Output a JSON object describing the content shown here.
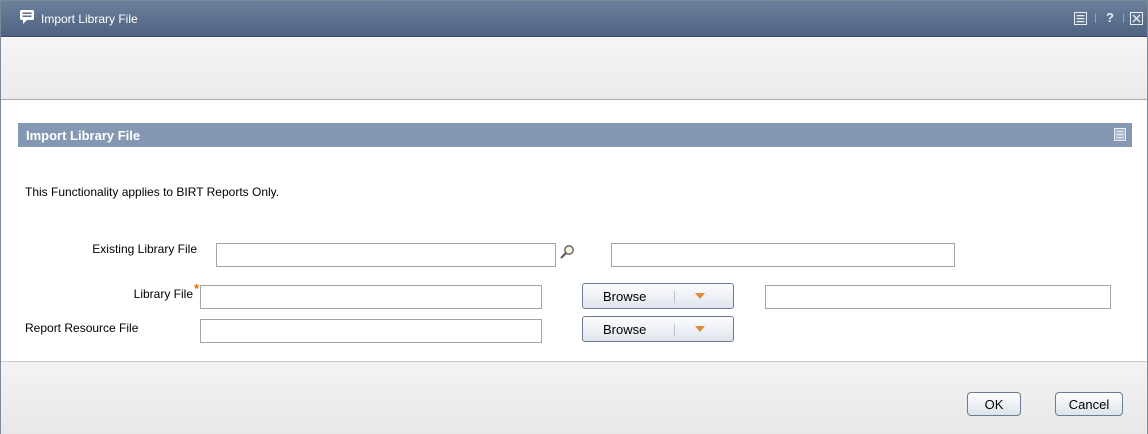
{
  "window": {
    "title": "Import Library File",
    "controls": [
      "popout-icon",
      "help-icon",
      "close-icon"
    ],
    "help_glyph": "?"
  },
  "section": {
    "title": "Import Library File",
    "note": "This Functionality applies to BIRT Reports Only."
  },
  "form": {
    "existing_library_file": {
      "label": "Existing Library File",
      "value": "",
      "description": ""
    },
    "library_file": {
      "label": "Library File",
      "required_mark": "*",
      "value": "",
      "browse_label": "Browse",
      "file_name": ""
    },
    "report_resource_file": {
      "label": "Report Resource File",
      "value": "",
      "browse_label": "Browse"
    }
  },
  "footer": {
    "ok_label": "OK",
    "cancel_label": "Cancel"
  },
  "colors": {
    "titlebar": "#4d6381",
    "section_header": "#8598b3",
    "required": "#e06a00",
    "dropdown_arrow": "#e0873a"
  }
}
